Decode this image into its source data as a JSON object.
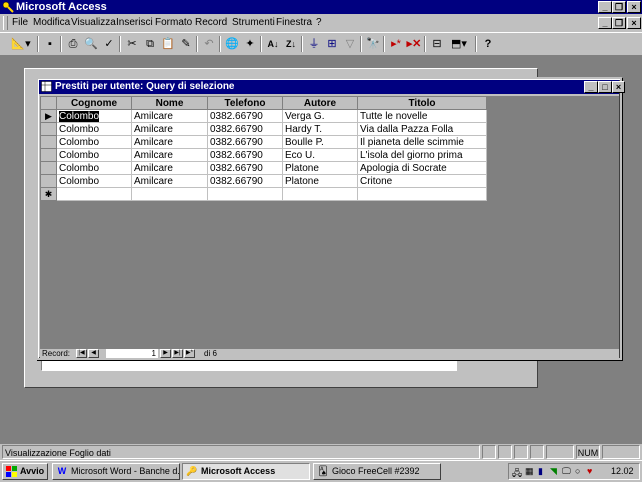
{
  "app": {
    "title": "Microsoft Access",
    "icon": "key-icon"
  },
  "menu": [
    "File",
    "Modifica",
    "Visualizza",
    "Inserisci",
    "Formato",
    "Record",
    "Strumenti",
    "Finestra",
    "?"
  ],
  "toolbar": {
    "icons": [
      "design-view-icon",
      "save-icon",
      "print-icon",
      "print-preview-icon",
      "spelling-icon",
      "cut-icon",
      "copy-icon",
      "paste-icon",
      "format-painter-icon",
      "undo-icon",
      "insert-hyperlink-icon",
      "web-toolbar-icon",
      "sort-ascending-icon",
      "sort-descending-icon",
      "filter-by-selection-icon",
      "filter-by-form-icon",
      "apply-filter-icon",
      "find-icon",
      "new-record-icon",
      "delete-record-icon",
      "database-window-icon",
      "new-object-icon",
      "help-icon"
    ]
  },
  "query_window": {
    "title": "Prestiti per utente: Query di selezione",
    "columns": [
      "Cognome",
      "Nome",
      "Telefono",
      "Autore",
      "Titolo"
    ],
    "rows": [
      [
        "Colombo",
        "Amilcare",
        "0382.66790",
        "Verga G.",
        "Tutte le novelle"
      ],
      [
        "Colombo",
        "Amilcare",
        "0382.66790",
        "Hardy T.",
        "Via dalla Pazza Folla"
      ],
      [
        "Colombo",
        "Amilcare",
        "0382.66790",
        "Boulle P.",
        "Il pianeta delle scimmie"
      ],
      [
        "Colombo",
        "Amilcare",
        "0382.66790",
        "Eco U.",
        "L'isola del giorno prima"
      ],
      [
        "Colombo",
        "Amilcare",
        "0382.66790",
        "Platone",
        "Apologia di Socrate"
      ],
      [
        "Colombo",
        "Amilcare",
        "0382.66790",
        "Platone",
        "Critone"
      ]
    ],
    "record_label": "Record:",
    "current_record": "1",
    "total_records": "di 6"
  },
  "status": {
    "text": "Visualizzazione Foglio dati",
    "num": "NUM"
  },
  "taskbar": {
    "start": "Avvio",
    "tasks": [
      {
        "label": "Microsoft Word - Banche d...",
        "icon": "word-icon"
      },
      {
        "label": "Microsoft Access",
        "icon": "access-icon"
      },
      {
        "label": "Gioco FreeCell #2392",
        "icon": "freecell-icon"
      }
    ],
    "clock": "12.02"
  }
}
